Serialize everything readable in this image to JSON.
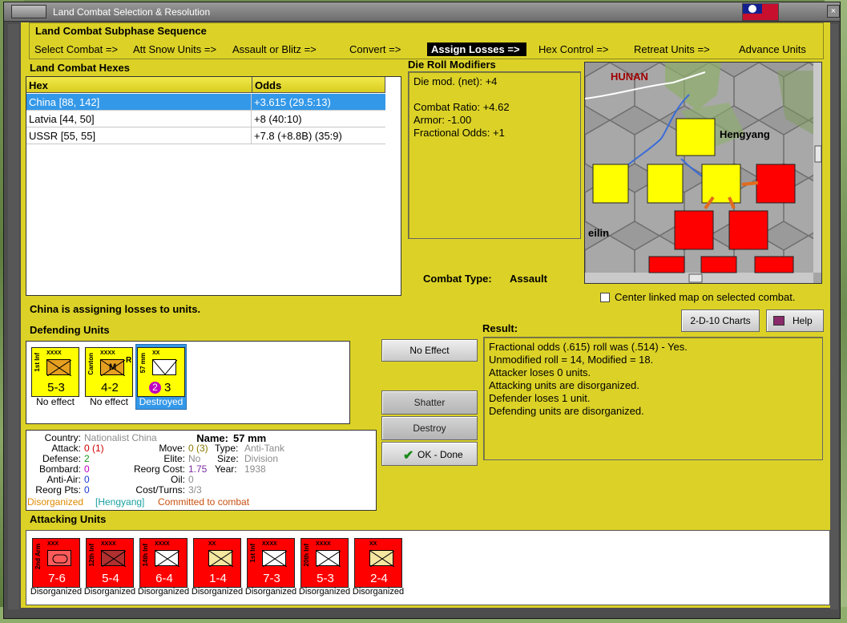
{
  "window": {
    "title": "Land Combat Selection & Resolution",
    "close_glyph": "×",
    "flag": "nationalist-china-flag"
  },
  "sequence": {
    "title": "Land Combat Subphase Sequence",
    "steps": [
      "Select Combat =>",
      "Att Snow Units =>",
      "Assault or Blitz =>",
      "Convert =>",
      "Assign Losses =>",
      "Hex Control =>",
      "Retreat Units =>",
      "Advance Units"
    ],
    "active_index": 4
  },
  "hexes": {
    "title": "Land Combat Hexes",
    "columns": [
      "Hex",
      "Odds"
    ],
    "rows": [
      {
        "hex": "China [88, 142]",
        "odds": "+3.615 (29.5:13)",
        "selected": true
      },
      {
        "hex": "Latvia [44, 50]",
        "odds": "+8 (40:10)",
        "selected": false
      },
      {
        "hex": "USSR [55, 55]",
        "odds": "+7.8 (+8.8B) (35:9)",
        "selected": false
      }
    ]
  },
  "drm": {
    "title": "Die Roll Modifiers",
    "lines": [
      "Die mod. (net): +4",
      "",
      "Combat Ratio: +4.62",
      "Armor: -1.00",
      "Fractional Odds: +1"
    ]
  },
  "map": {
    "labels": {
      "region": "HUNAN",
      "city": "Hengyang",
      "partial_city": "eilin"
    }
  },
  "combat_type": {
    "label": "Combat Type:",
    "value": "Assault"
  },
  "center_map": {
    "label": "Center linked map on selected combat.",
    "checked": false
  },
  "status_message": "China is assigning losses to units.",
  "buttons": {
    "charts": "2-D-10 Charts",
    "help": "Help",
    "no_effect": "No Effect",
    "shatter": "Shatter",
    "destroy": "Destroy",
    "ok_done": "OK - Done"
  },
  "defending": {
    "title": "Defending Units",
    "units": [
      {
        "side": "1st Inf",
        "size": "XXXX",
        "stat": "5-3",
        "caption": "No effect",
        "type": "infantry"
      },
      {
        "side": "Canton",
        "size": "XXXX",
        "stat": "4-2",
        "caption": "No effect",
        "type": "militia",
        "badge": "M",
        "flag": "R"
      },
      {
        "side": "57 mm",
        "size": "XX",
        "stat": "3",
        "stat_prefix": "2",
        "caption": "Destroyed",
        "type": "anti-tank",
        "selected": true
      }
    ]
  },
  "result": {
    "title": "Result:",
    "lines": [
      "Fractional odds (.615) roll was (.514)  - Yes.",
      "Unmodified roll = 14, Modified = 18.",
      "Attacker loses 0 units.",
      "Attacking units are disorganized.",
      "Defender loses 1 unit.",
      "Defending units are disorganized."
    ]
  },
  "info": {
    "country_label": "Country:",
    "country": "Nationalist China",
    "name_label": "Name:",
    "name": "57 mm",
    "attack_label": "Attack:",
    "attack": "0 (1)",
    "move_label": "Move:",
    "move": "0 (3)",
    "type_label": "Type:",
    "type": "Anti-Tank",
    "defense_label": "Defense:",
    "defense": "2",
    "elite_label": "Elite:",
    "elite": "No",
    "size_label": "Size:",
    "size": "Division",
    "bombard_label": "Bombard:",
    "bombard": "0",
    "reorg_cost_label": "Reorg Cost:",
    "reorg_cost": "1.75",
    "year_label": "Year:",
    "year": "1938",
    "antiair_label": "Anti-Air:",
    "antiair": "0",
    "oil_label": "Oil:",
    "oil": "0",
    "reorg_pts_label": "Reorg Pts:",
    "reorg_pts": "0",
    "cost_turns_label": "Cost/Turns:",
    "cost_turns": "3/3",
    "status_disorganized": "Disorganized",
    "status_location": "[Hengyang]",
    "status_committed": "Committed to combat"
  },
  "attacking": {
    "title": "Attacking Units",
    "units": [
      {
        "side": "2nd Arm",
        "size": "XXX",
        "stat": "7-6",
        "caption": "Disorganized",
        "type": "armor"
      },
      {
        "side": "12th Inf",
        "size": "XXXX",
        "stat": "5-4",
        "caption": "Disorganized",
        "type": "infantry-dark"
      },
      {
        "side": "14th Inf",
        "size": "XXXX",
        "stat": "6-4",
        "caption": "Disorganized",
        "type": "infantry"
      },
      {
        "side": "",
        "size": "XX",
        "stat": "1-4",
        "caption": "Disorganized",
        "type": "mountain"
      },
      {
        "side": "1st Inf",
        "size": "XXXX",
        "stat": "7-3",
        "caption": "Disorganized",
        "type": "infantry"
      },
      {
        "side": "20th Inf",
        "size": "XXXX",
        "stat": "5-3",
        "caption": "Disorganized",
        "type": "infantry"
      },
      {
        "side": "",
        "size": "XX",
        "stat": "2-4",
        "caption": "Disorganized",
        "type": "mountain"
      }
    ]
  },
  "colors": {
    "panel_yellow": "#dcd227",
    "selection_blue": "#3498e8",
    "japan_red": "#ff0000",
    "china_yellow": "#ffff00"
  }
}
